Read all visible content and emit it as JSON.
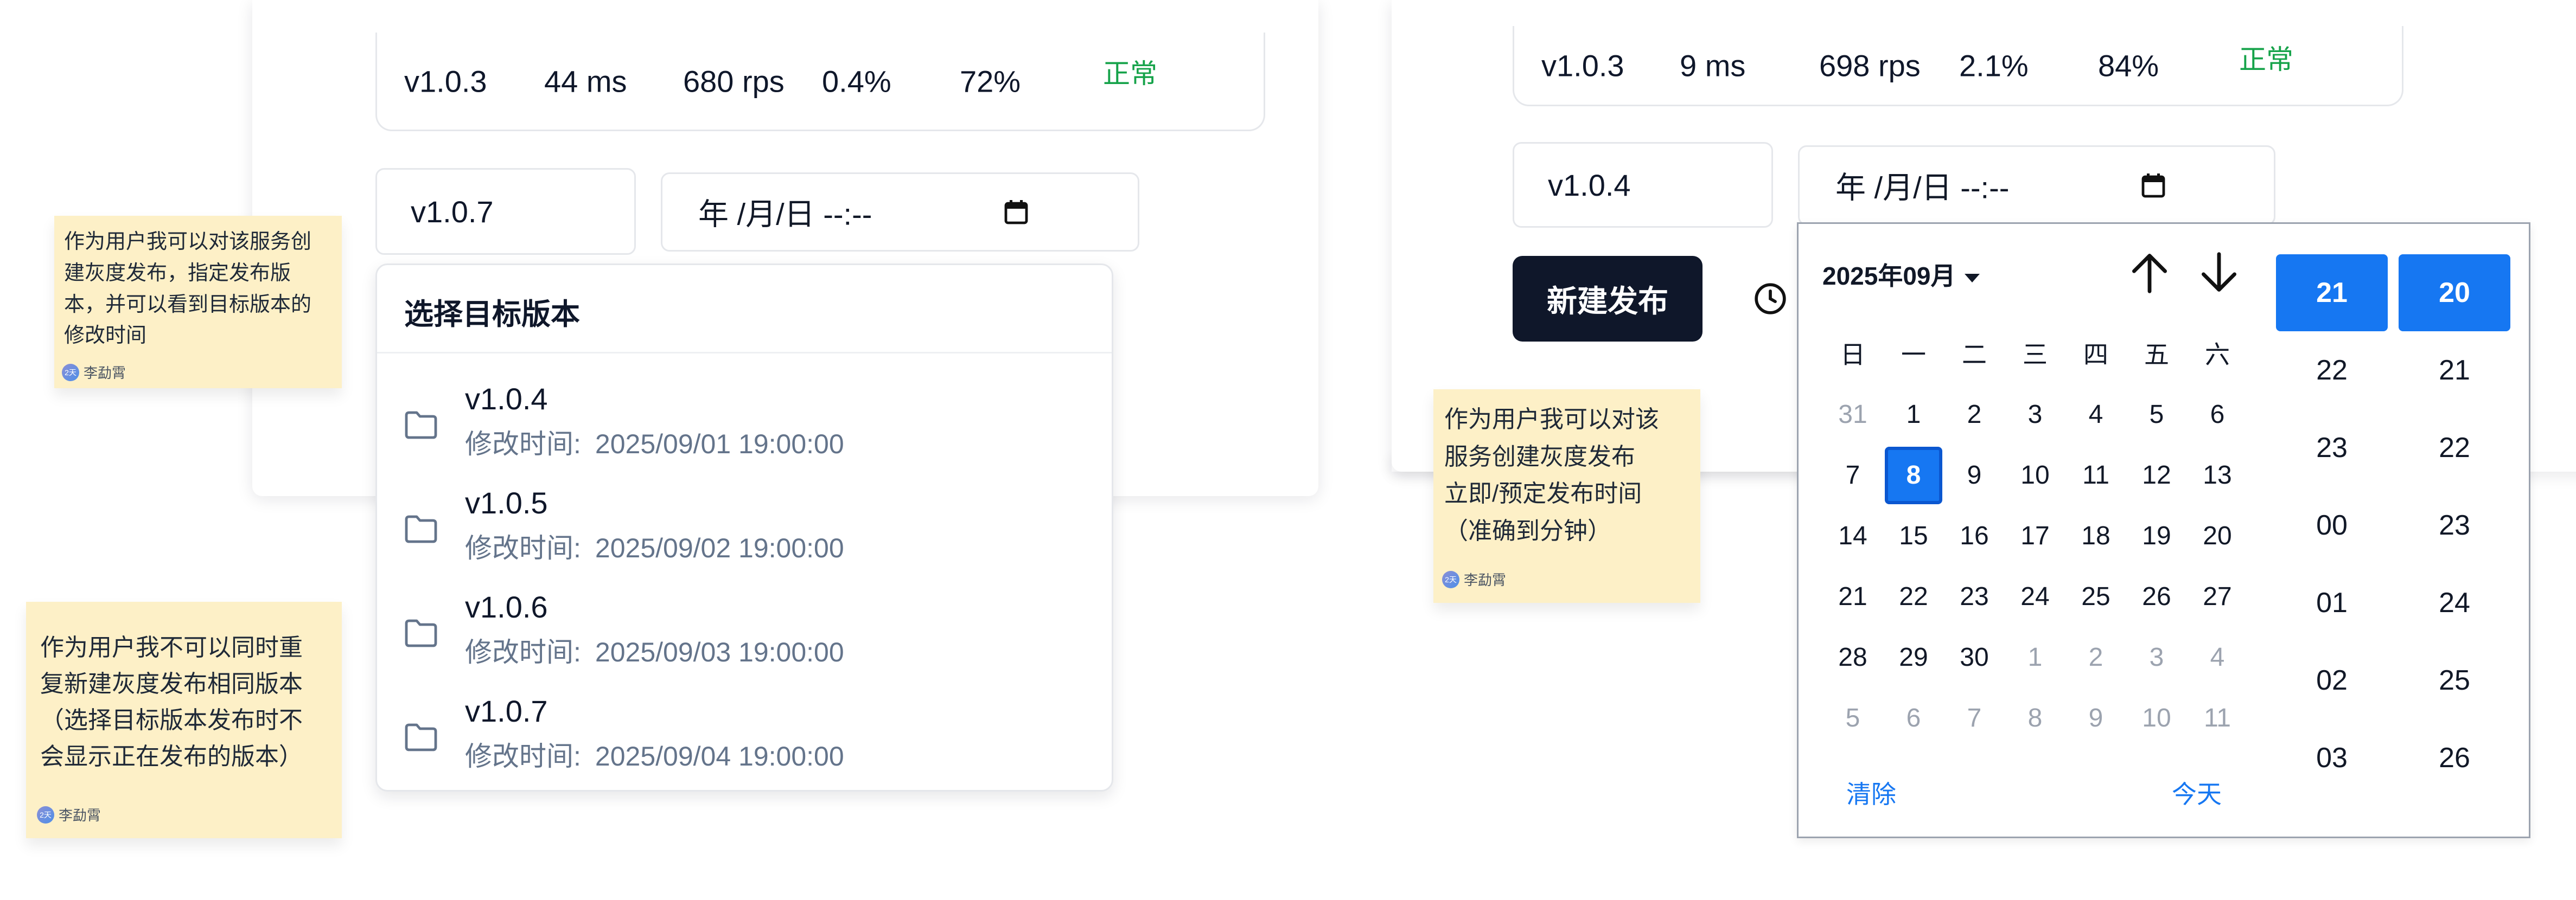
{
  "left": {
    "metrics": {
      "version": "v1.0.3",
      "latency": "44 ms",
      "throughput": "680 rps",
      "error_rate": "0.4%",
      "cpu": "72%",
      "status": "正常"
    },
    "version_select_value": "v1.0.7",
    "datetime_placeholder": "年 /月/日 --:--",
    "dropdown": {
      "title": "选择目标版本",
      "items": [
        {
          "version": "v1.0.4",
          "modified_label": "修改时间:",
          "modified_time": "2025/09/01 19:00:00"
        },
        {
          "version": "v1.0.5",
          "modified_label": "修改时间:",
          "modified_time": "2025/09/02 19:00:00"
        },
        {
          "version": "v1.0.6",
          "modified_label": "修改时间:",
          "modified_time": "2025/09/03 19:00:00"
        },
        {
          "version": "v1.0.7",
          "modified_label": "修改时间:",
          "modified_time": "2025/09/04 19:00:00"
        }
      ]
    }
  },
  "notes": [
    {
      "lines": [
        "作为用户我可以对该服务创",
        "建灰度发布，指定发布版",
        "本，并可以看到目标版本的",
        "修改时间"
      ],
      "author": "李勐霄",
      "avatar_text": "2天"
    },
    {
      "lines": [
        "作为用户我不可以同时重",
        "复新建灰度发布相同版本",
        "（选择目标版本发布时不",
        "会显示正在发布的版本）"
      ],
      "author": "李勐霄",
      "avatar_text": "2天"
    },
    {
      "lines": [
        "作为用户我可以对该",
        "服务创建灰度发布",
        "立即/预定发布时间",
        "（准确到分钟）"
      ],
      "author": "李勐霄",
      "avatar_text": "2天"
    }
  ],
  "right": {
    "metrics": {
      "version": "v1.0.3",
      "latency": "9 ms",
      "throughput": "698 rps",
      "error_rate": "2.1%",
      "cpu": "84%",
      "status": "正常"
    },
    "version_select_value": "v1.0.4",
    "datetime_placeholder": "年 /月/日 --:--",
    "new_release_button": "新建发布",
    "picker": {
      "month_label": "2025年09月",
      "weekdays": [
        "日",
        "一",
        "二",
        "三",
        "四",
        "五",
        "六"
      ],
      "weeks": [
        [
          "31",
          "1",
          "2",
          "3",
          "4",
          "5",
          "6"
        ],
        [
          "7",
          "8",
          "9",
          "10",
          "11",
          "12",
          "13"
        ],
        [
          "14",
          "15",
          "16",
          "17",
          "18",
          "19",
          "20"
        ],
        [
          "21",
          "22",
          "23",
          "24",
          "25",
          "26",
          "27"
        ],
        [
          "28",
          "29",
          "30",
          "1",
          "2",
          "3",
          "4"
        ],
        [
          "5",
          "6",
          "7",
          "8",
          "9",
          "10",
          "11"
        ]
      ],
      "selected_day": "8",
      "clear_label": "清除",
      "today_label": "今天",
      "hours": [
        "21",
        "22",
        "23",
        "00",
        "01",
        "02",
        "03"
      ],
      "minutes": [
        "20",
        "21",
        "22",
        "23",
        "24",
        "25",
        "26"
      ],
      "selected_hour": "21",
      "selected_minute": "20"
    }
  },
  "colors": {
    "accent": "#1677f2",
    "status_green": "#16a34a",
    "sticky_bg": "#fdf0c7",
    "dark_button": "#0f172a"
  },
  "icons": [
    "calendar-icon",
    "folder-icon",
    "clock-icon",
    "arrow-up-icon",
    "arrow-down-icon",
    "caret-down-icon"
  ]
}
